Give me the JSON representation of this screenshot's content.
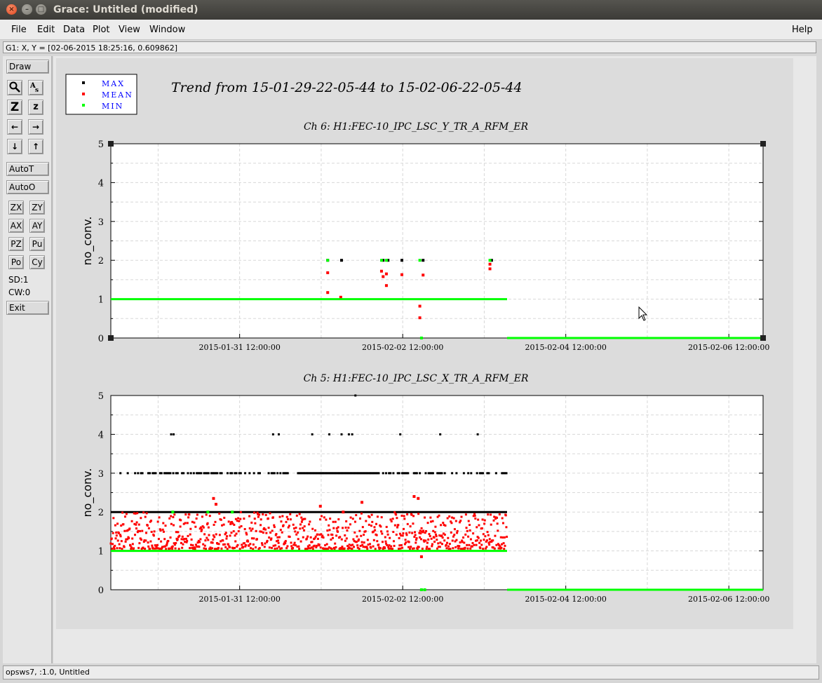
{
  "window": {
    "title": "Grace: Untitled (modified)"
  },
  "menubar": {
    "items": [
      {
        "label": "File"
      },
      {
        "label": "Edit"
      },
      {
        "label": "Data"
      },
      {
        "label": "Plot"
      },
      {
        "label": "View"
      },
      {
        "label": "Window"
      }
    ],
    "help": "Help"
  },
  "locator": "G1: X, Y = [02-06-2015 18:25:16, 0.609862]",
  "toolbar": {
    "draw": "Draw",
    "autot": "AutoT",
    "autoo": "AutoO",
    "zx": "ZX",
    "zy": "ZY",
    "ax": "AX",
    "ay": "AY",
    "pz": "PZ",
    "pu": "Pu",
    "po": "Po",
    "cy": "Cy",
    "sd": "SD:1",
    "cw": "CW:0",
    "exit": "Exit",
    "zoom_in": "Z",
    "zoom_out": "z"
  },
  "legend": {
    "items": [
      {
        "label": "MAX",
        "color": "#000000"
      },
      {
        "label": "MEAN",
        "color": "#ff0000"
      },
      {
        "label": "MIN",
        "color": "#00ff00"
      }
    ]
  },
  "page_title": "Trend from 15-01-29-22-05-44 to 15-02-06-22-05-44",
  "status": "opsws7, :1.0, Untitled",
  "chart_data": [
    {
      "type": "scatter",
      "title": "Ch 6: H1:FEC-10_IPC_LSC_Y_TR_A_RFM_ER",
      "ylabel": "no_conv.",
      "ylim": [
        0,
        5
      ],
      "yticks": [
        "0",
        "1",
        "2",
        "3",
        "4",
        "5"
      ],
      "xlim": [
        "2015-01-29 22:05:44",
        "2015-02-06 22:05:44"
      ],
      "xticks": [
        "2015-01-31 12:00:00",
        "2015-02-02 12:00:00",
        "2015-02-04 12:00:00",
        "2015-02-06 12:00:00"
      ],
      "series": [
        {
          "name": "MAX",
          "color": "#000000",
          "points": [
            [
              2.66,
              2
            ],
            [
              2.83,
              2
            ],
            [
              3.34,
              2
            ],
            [
              3.4,
              2
            ],
            [
              3.57,
              2
            ],
            [
              3.83,
              2
            ],
            [
              4.67,
              2
            ]
          ]
        },
        {
          "name": "MEAN",
          "color": "#ff0000",
          "points": [
            [
              2.66,
              1.68
            ],
            [
              2.66,
              1.17
            ],
            [
              2.82,
              1.05
            ],
            [
              3.32,
              1.72
            ],
            [
              3.34,
              1.58
            ],
            [
              3.38,
              1.65
            ],
            [
              3.38,
              1.35
            ],
            [
              3.57,
              1.63
            ],
            [
              3.79,
              0.82
            ],
            [
              3.79,
              0.52
            ],
            [
              3.83,
              1.62
            ],
            [
              4.65,
              1.9
            ],
            [
              4.65,
              1.78
            ]
          ]
        },
        {
          "name": "MIN",
          "color": "#00ff00",
          "segments": [
            [
              [
                0,
                1
              ],
              [
                4.86,
                1
              ]
            ],
            [
              [
                4.86,
                0
              ],
              [
                8,
                0
              ]
            ]
          ],
          "points": [
            [
              2.66,
              2
            ],
            [
              3.32,
              2
            ],
            [
              3.38,
              2
            ],
            [
              3.79,
              2
            ],
            [
              3.81,
              0
            ],
            [
              4.65,
              2
            ]
          ]
        }
      ]
    },
    {
      "type": "scatter",
      "title": "Ch 5: H1:FEC-10_IPC_LSC_X_TR_A_RFM_ER",
      "ylabel": "no_conv.",
      "ylim": [
        0,
        5
      ],
      "yticks": [
        "0",
        "1",
        "2",
        "3",
        "4",
        "5"
      ],
      "xlim": [
        "2015-01-29 22:05:44",
        "2015-02-06 22:05:44"
      ],
      "xticks": [
        "2015-01-31 12:00:00",
        "2015-02-02 12:00:00",
        "2015-02-04 12:00:00",
        "2015-02-06 12:00:00"
      ],
      "series": [
        {
          "name": "MAX",
          "color": "#000000",
          "baseline": {
            "y": 2,
            "x": [
              0,
              4.86
            ]
          },
          "levels": [
            {
              "y": 3,
              "density": 0.55
            },
            {
              "y": 4,
              "x": [
                0.74,
                0.77,
                1.99,
                2.06,
                2.47,
                2.68,
                2.83,
                2.92,
                2.96,
                3.55,
                4.04,
                4.5
              ]
            },
            {
              "y": 5,
              "x": [
                3.0
              ]
            }
          ]
        },
        {
          "name": "MEAN",
          "color": "#ff0000",
          "cloud": {
            "x": [
              0,
              4.86
            ],
            "y_low": 1.0,
            "y_high": 1.95
          },
          "outliers": [
            [
              1.26,
              2.35
            ],
            [
              1.29,
              2.2
            ],
            [
              2.57,
              2.15
            ],
            [
              3.08,
              2.25
            ],
            [
              3.72,
              2.4
            ],
            [
              3.77,
              2.35
            ],
            [
              3.81,
              0.85
            ],
            [
              2.85,
              2.0
            ]
          ]
        },
        {
          "name": "MIN",
          "color": "#00ff00",
          "segments": [
            [
              [
                0,
                1
              ],
              [
                4.86,
                1
              ]
            ],
            [
              [
                4.86,
                0
              ],
              [
                8,
                0
              ]
            ]
          ],
          "points": [
            [
              0.76,
              2
            ],
            [
              1.19,
              2
            ],
            [
              1.49,
              2
            ],
            [
              3.85,
              0
            ],
            [
              3.81,
              0
            ]
          ]
        }
      ]
    }
  ]
}
